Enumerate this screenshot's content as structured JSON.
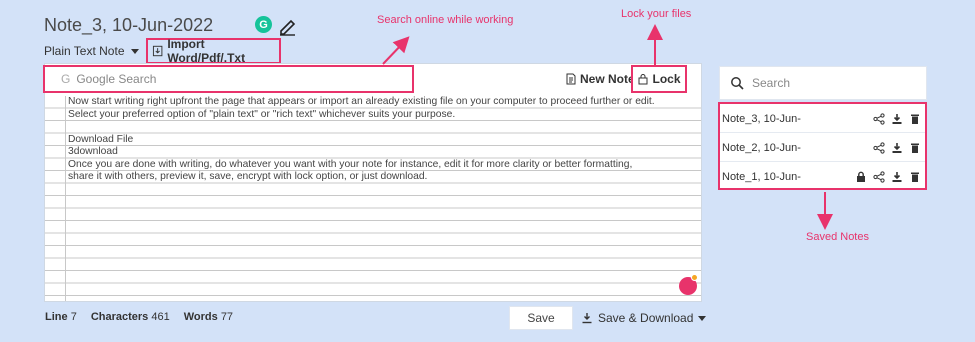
{
  "header": {
    "title": "Note_3, 10-Jun-2022",
    "grammarly_badge": "G",
    "mode_label": "Plain Text Note",
    "import_label": "Import Word/Pdf/.Txt"
  },
  "annotations": {
    "search": "Search online while working",
    "lock": "Lock your files",
    "saved": "Saved Notes"
  },
  "toolbar": {
    "google_search_placeholder": "Google Search",
    "new_note_label": "New Note",
    "lock_label": "Lock"
  },
  "editor": {
    "lines": [
      "Now start writing right upfront the page that appears or import an already existing file on your computer to proceed further or edit.",
      "Select your preferred option of \"plain text\" or \"rich text\" whichever suits your purpose.",
      "",
      "Download File",
      "3download",
      "Once you are done with writing, do whatever you want with your note for instance, edit it for more clarity or better formatting,",
      "share it with others, preview it, save, encrypt with lock option, or just download."
    ]
  },
  "footer": {
    "line_label": "Line",
    "line_value": "7",
    "chars_label": "Characters",
    "chars_value": "461",
    "words_label": "Words",
    "words_value": "77",
    "save_label": "Save",
    "save_download_label": "Save & Download"
  },
  "sidebar": {
    "search_placeholder": "Search",
    "notes": [
      {
        "name": "Note_3, 10-Jun-",
        "locked": false
      },
      {
        "name": "Note_2, 10-Jun-",
        "locked": false
      },
      {
        "name": "Note_1, 10-Jun-",
        "locked": true
      }
    ]
  },
  "colors": {
    "accent": "#e8336b",
    "background": "#d3e2f8",
    "grammarly": "#15c39a"
  }
}
